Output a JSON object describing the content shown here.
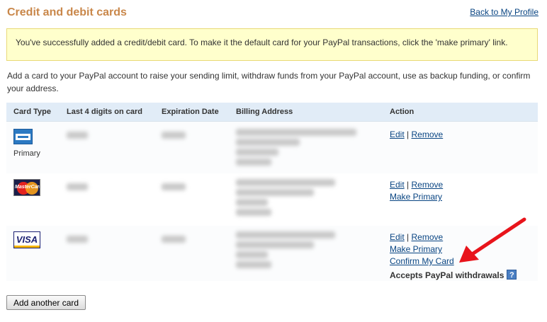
{
  "page": {
    "title": "Credit and debit cards",
    "back_link": "Back to My Profile"
  },
  "notice": {
    "text": "You've successfully added a credit/debit card. To make it the default card for your PayPal transactions, click the 'make primary' link."
  },
  "intro": {
    "text": "Add a card to your PayPal account to raise your sending limit, withdraw funds from your PayPal account, use as backup funding, or confirm your address."
  },
  "table": {
    "columns": [
      "Card Type",
      "Last 4 digits on card",
      "Expiration Date",
      "Billing Address",
      "Action"
    ],
    "rows": [
      {
        "card_type": "amex-logo",
        "primary_label": "Primary",
        "edit": "Edit",
        "separator": "|",
        "remove": "Remove"
      },
      {
        "card_type": "mastercard-logo",
        "logo_text": "MasterCard",
        "edit": "Edit",
        "separator": "|",
        "remove": "Remove",
        "make_primary": "Make Primary"
      },
      {
        "card_type": "visa-logo",
        "logo_text": "VISA",
        "edit": "Edit",
        "separator": "|",
        "remove": "Remove",
        "make_primary": "Make Primary",
        "confirm": "Confirm My Card",
        "withdrawals": "Accepts PayPal withdrawals",
        "help_glyph": "?"
      }
    ]
  },
  "buttons": {
    "add_card": "Add another card"
  },
  "colors": {
    "title": "#c9874a",
    "link": "#084482",
    "notice_bg": "#ffffcc",
    "header_bg": "#e1ecf7",
    "arrow": "#e8141b"
  }
}
